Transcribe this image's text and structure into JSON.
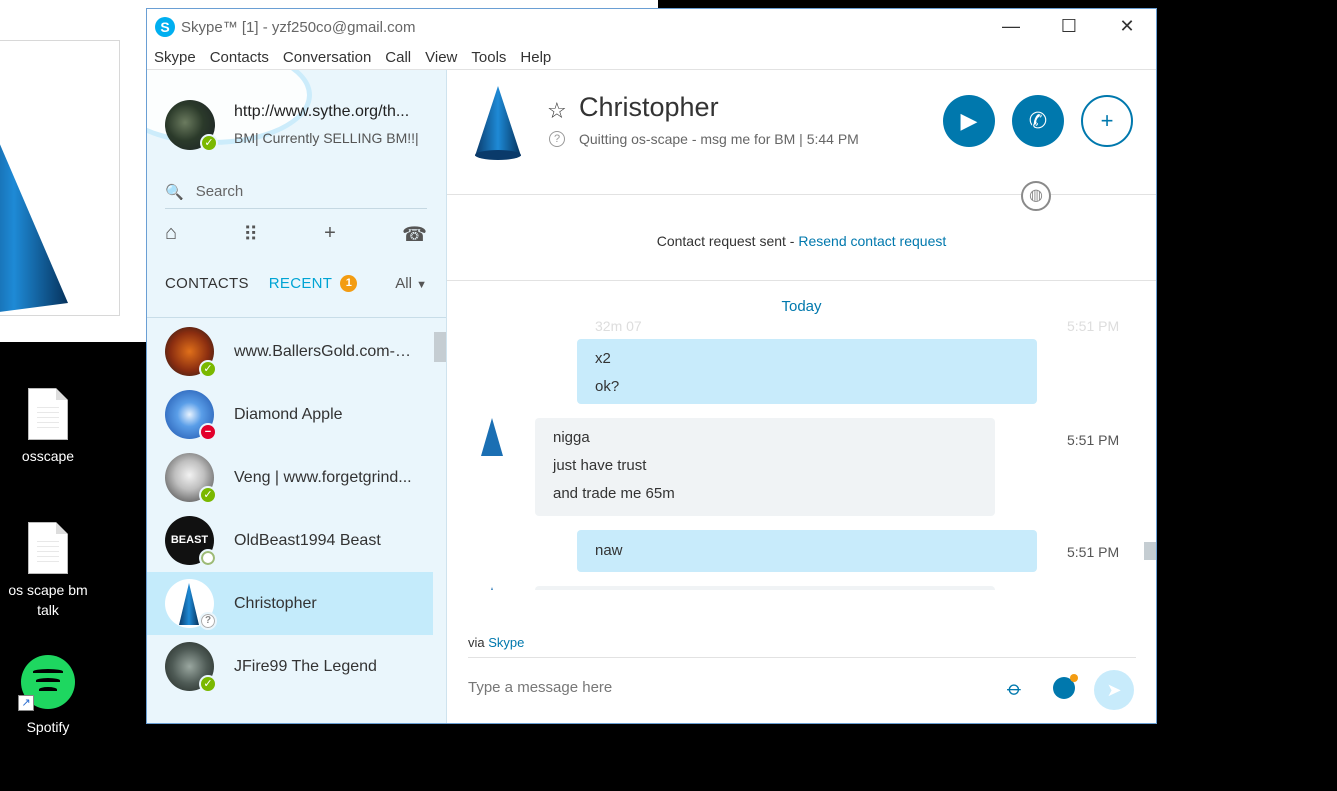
{
  "desktop": {
    "icons": [
      {
        "label": "osscape"
      },
      {
        "label": "os scape bm talk"
      },
      {
        "label": "Spotify"
      }
    ]
  },
  "window": {
    "title": "Skype™ [1] - yzf250co@gmail.com",
    "controls": {
      "minimize": "—",
      "maximize": "☐",
      "close": "✕"
    }
  },
  "menu": [
    "Skype",
    "Contacts",
    "Conversation",
    "Call",
    "View",
    "Tools",
    "Help"
  ],
  "profile": {
    "url": "http://www.sythe.org/th...",
    "mood": "BM| Currently SELLING BM!!|"
  },
  "search": {
    "placeholder": "Search"
  },
  "tabs": {
    "contacts": "CONTACTS",
    "recent": "RECENT",
    "recent_badge": "1",
    "filter": "All"
  },
  "contacts": [
    {
      "name": "www.BallersGold.com-T...",
      "status": "online"
    },
    {
      "name": "Diamond Apple",
      "status": "busy"
    },
    {
      "name": "Veng | www.forgetgrind...",
      "status": "online"
    },
    {
      "name": "OldBeast1994 Beast",
      "status": "offline"
    },
    {
      "name": "Christopher",
      "status": "unknown"
    },
    {
      "name": "JFire99 The Legend",
      "status": "online"
    }
  ],
  "conversation": {
    "name": "Christopher",
    "mood": "Quitting os-scape - msg me for BM  |  5:44 PM",
    "request_text": "Contact request sent - ",
    "request_link": "Resend contact request",
    "today_label": "Today",
    "messages": [
      {
        "dir": "out",
        "lines": [
          "x2",
          "ok?"
        ],
        "time": ""
      },
      {
        "dir": "in",
        "lines": [
          "nigga",
          "just have trust",
          "and trade me 65m"
        ],
        "time": "5:51 PM"
      },
      {
        "dir": "out",
        "lines": [
          "naw"
        ],
        "time": "5:51 PM"
      }
    ],
    "ghost_text": "32m 07",
    "ghost_time": "5:51 PM",
    "via_prefix": "via ",
    "via_link": "Skype",
    "input_placeholder": "Type a message here"
  },
  "colors": {
    "skype_blue": "#00aff0",
    "accent": "#0078ad",
    "bubble_out": "#c8ebfb",
    "online": "#7ab800",
    "busy": "#e2002b"
  }
}
